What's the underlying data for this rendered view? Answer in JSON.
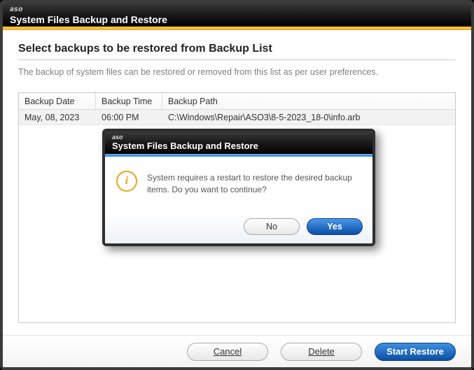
{
  "brand": "aso",
  "window_title": "System Files Backup and Restore",
  "heading": "Select backups to be restored from Backup List",
  "subtext": "The backup of system files can be restored or removed from this list as per user preferences.",
  "columns": {
    "date": "Backup Date",
    "time": "Backup Time",
    "path": "Backup Path"
  },
  "rows": [
    {
      "date": "May, 08, 2023",
      "time": "06:00 PM",
      "path": "C:\\Windows\\Repair\\ASO3\\8-5-2023_18-0\\info.arb"
    }
  ],
  "footer": {
    "cancel": "Cancel",
    "delete": "Delete",
    "start": "Start Restore"
  },
  "dialog": {
    "brand": "aso",
    "title": "System Files Backup and Restore",
    "message": "System requires a restart to restore the desired backup items. Do you want to continue?",
    "no": "No",
    "yes": "Yes"
  }
}
